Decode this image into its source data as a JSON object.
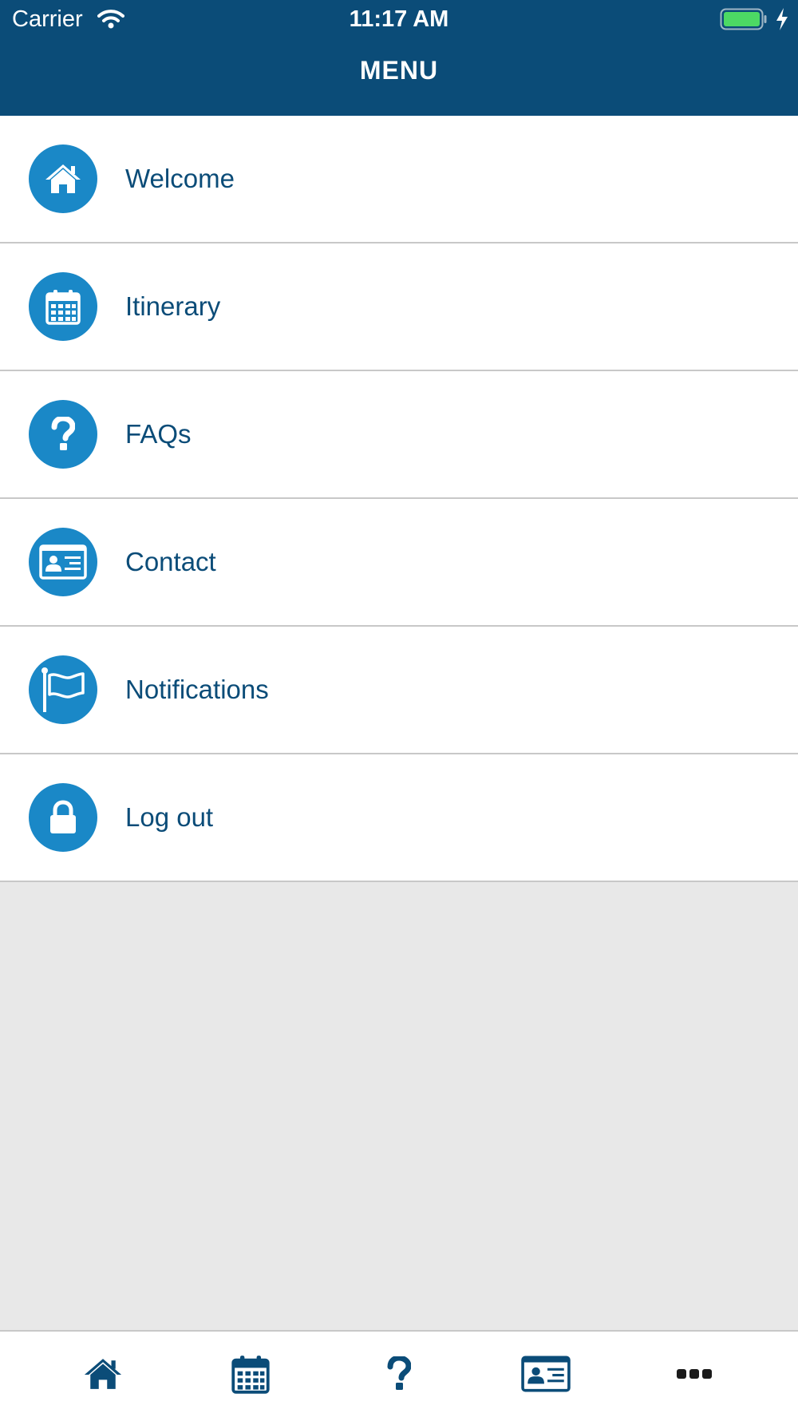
{
  "status_bar": {
    "carrier": "Carrier",
    "time": "11:17 AM"
  },
  "header": {
    "title": "MENU"
  },
  "menu": {
    "items": [
      {
        "label": "Welcome",
        "icon": "home-icon"
      },
      {
        "label": "Itinerary",
        "icon": "calendar-icon"
      },
      {
        "label": "FAQs",
        "icon": "question-icon"
      },
      {
        "label": "Contact",
        "icon": "contact-card-icon"
      },
      {
        "label": "Notifications",
        "icon": "flag-icon"
      },
      {
        "label": "Log out",
        "icon": "lock-icon"
      }
    ]
  },
  "tab_bar": {
    "tabs": [
      {
        "icon": "home-icon"
      },
      {
        "icon": "calendar-icon"
      },
      {
        "icon": "question-icon"
      },
      {
        "icon": "contact-card-icon"
      },
      {
        "icon": "more-icon"
      }
    ]
  },
  "colors": {
    "header_bg": "#0b4c78",
    "icon_circle": "#1a88c7",
    "label_text": "#0b4c78",
    "tab_icon": "#0b4c78",
    "empty_area": "#e8e8e8",
    "battery": "#4cd964"
  }
}
